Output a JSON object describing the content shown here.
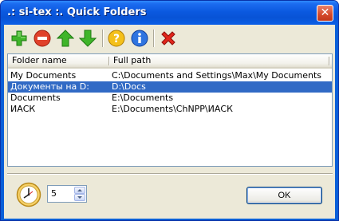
{
  "window": {
    "title": ".: si-tex :. Quick Folders"
  },
  "toolbar": {
    "buttons": [
      {
        "icon": "add-icon",
        "color": "#2e9d1f"
      },
      {
        "icon": "remove-icon",
        "color": "#d8321e"
      },
      {
        "icon": "move-up-icon",
        "color": "#2e9d1f"
      },
      {
        "icon": "move-down-icon",
        "color": "#2e9d1f"
      },
      {
        "icon": "help-icon",
        "color": "#f0b400"
      },
      {
        "icon": "info-icon",
        "color": "#2668d8"
      },
      {
        "icon": "delete-icon",
        "color": "#e0201a"
      }
    ]
  },
  "list": {
    "columns": [
      "Folder name",
      "Full path"
    ],
    "rows": [
      {
        "name": "My Documents",
        "path": "C:\\Documents and Settings\\Max\\My Documents",
        "selected": false
      },
      {
        "name": "Документы на D:",
        "path": "D:\\Docs",
        "selected": true
      },
      {
        "name": "Documents",
        "path": "E:\\Documents",
        "selected": false
      },
      {
        "name": "ИАСК",
        "path": "E:\\Documents\\ChNPP\\ИАСК",
        "selected": false
      }
    ]
  },
  "delay": {
    "icon": "clock-icon",
    "value": "5"
  },
  "ok_label": "OK",
  "close_glyph": "✕",
  "colors": {
    "titlebar": "#0853d6",
    "selection": "#316ac5",
    "dialog_face": "#ece9d8"
  }
}
